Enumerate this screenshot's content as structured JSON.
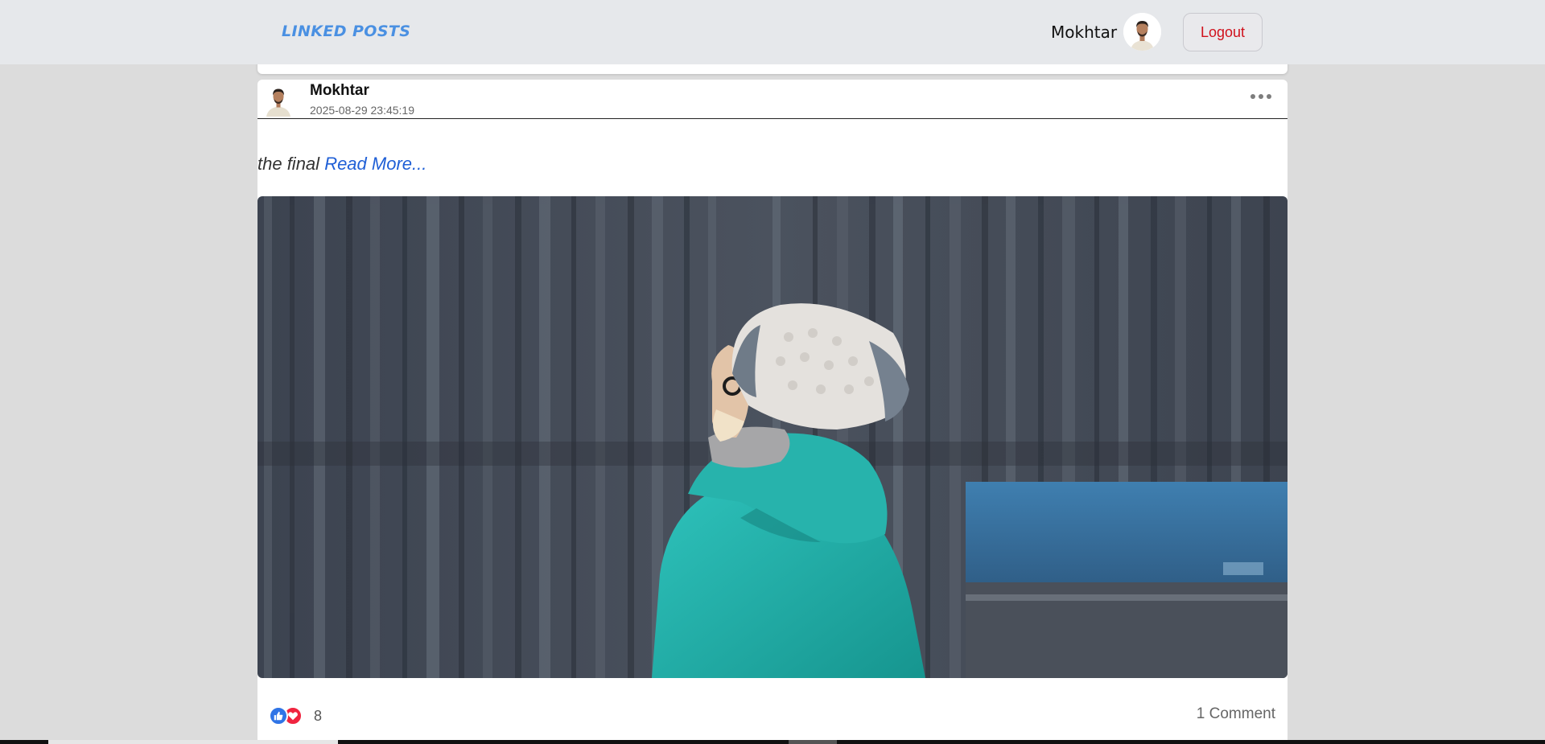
{
  "nav": {
    "brand": "LINKED POSTS",
    "user_name": "Mokhtar",
    "logout_label": "Logout"
  },
  "post": {
    "author": "Mokhtar",
    "date": "2025-08-29 23:45:19",
    "text": "the final",
    "read_more": "Read More...",
    "reaction_count": "8",
    "comments_label": "1 Comment"
  },
  "colors": {
    "brand": "#4a90e2",
    "logout": "#d0111c",
    "link": "#1f5fd6",
    "like": "#2f74e6",
    "love": "#f0243f"
  },
  "icons": {
    "menu": "more-horizontal-icon",
    "like": "thumbs-up-icon",
    "love": "heart-icon"
  }
}
